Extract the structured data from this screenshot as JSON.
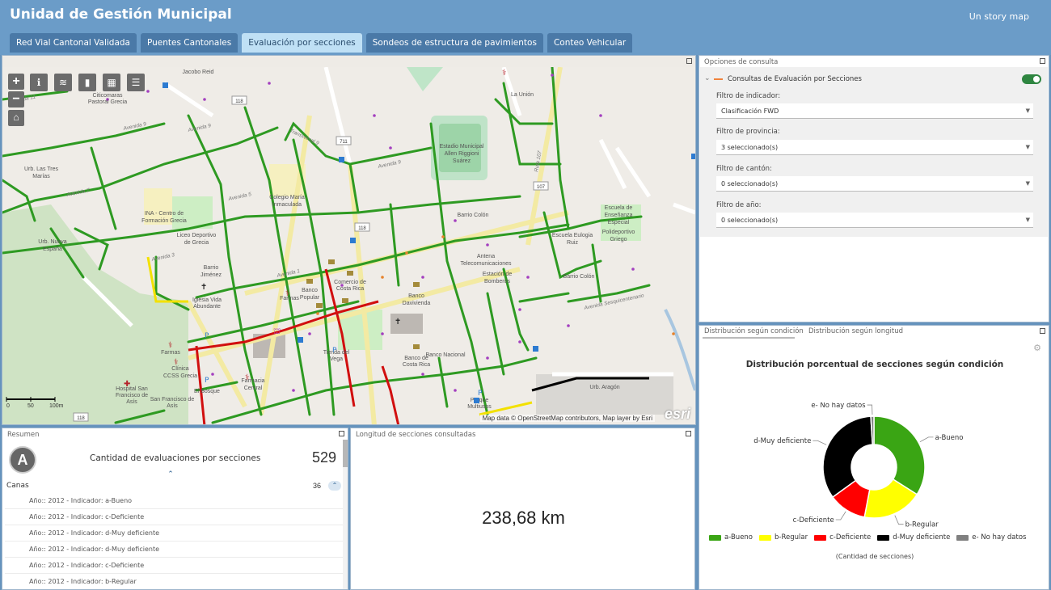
{
  "header": {
    "title": "Unidad de Gestión Municipal",
    "story_link": "Un story map"
  },
  "tabs": [
    {
      "label": "Red Vial Cantonal Validada",
      "active": false
    },
    {
      "label": "Puentes Cantonales",
      "active": false
    },
    {
      "label": "Evaluación por secciones",
      "active": true
    },
    {
      "label": "Sondeos de estructura de pavimientos",
      "active": false
    },
    {
      "label": "Conteo Vehicular",
      "active": false
    }
  ],
  "map": {
    "zoom_in": "+",
    "zoom_out": "−",
    "tools": [
      "info-icon",
      "layers-icon",
      "bookmark-icon",
      "basemap-icon",
      "legend-icon"
    ],
    "attribution": "Map data © OpenStreetMap contributors, Map layer by Esri",
    "esri_logo": "esri",
    "scale": {
      "labels": [
        "0",
        "50",
        "100m"
      ]
    },
    "places": [
      "La Unión",
      "Estadio Municipal Allen Riggioni Suárez",
      "Urb. Las Tres Marías",
      "Colegio María Inmaculada",
      "INA - Centro de Formación Grecia",
      "Liceo Deportivo de Grecia",
      "Barrio Colón",
      "Escuela de Enseñanza Especial",
      "Escuela Eulogia Ruiz",
      "Polideportivo Griego",
      "Urb. Nueva España",
      "Barrio Jiménez",
      "Banco Popular",
      "Farmas",
      "Barrio Colón",
      "Urb. Aragón",
      "Hospital San Francisco de Asís",
      "Clínica CCSS Grecia",
      "El Bosque",
      "Banco de Costa Rica",
      "Antena Telecomunicaciones",
      "Citicomaras Pastoral Grecia",
      "Banco Davivienda",
      "Comercio de Costa Rica",
      "Iglesia Vida Abundante",
      "Farmacia Central",
      "Parque Multiusos",
      "Estación de Bomberos",
      "Banco Nacional"
    ],
    "roads": [
      "Avenida 11",
      "Avenida 9",
      "Avenida 7",
      "Avenida 5",
      "Avenida 3",
      "Avenida 1",
      "Transversal 9",
      "Ruta 107",
      "Avenida Sesquicentenario"
    ],
    "route_shields": [
      "118",
      "711",
      "107",
      "118"
    ]
  },
  "options": {
    "panel_title": "Opciones de consulta",
    "group_label": "Consultas de Evaluación por Secciones",
    "filters": [
      {
        "label": "Filtro de indicador:",
        "value": "Clasificación FWD"
      },
      {
        "label": "Filtro de provincia:",
        "value": "3 seleccionado(s)"
      },
      {
        "label": "Filtro de cantón:",
        "value": "0 seleccionado(s)"
      },
      {
        "label": "Filtro de año:",
        "value": "0 seleccionado(s)"
      }
    ],
    "toggle_on": true
  },
  "resumen": {
    "panel_title": "Resumen",
    "badge": "A",
    "label": "Cantidad de evaluaciones por secciones",
    "count": "529",
    "group": {
      "name": "Canas",
      "count": "36"
    },
    "items": [
      "Año:: 2012 - Indicador: a-Bueno",
      "Año:: 2012 - Indicador: c-Deficiente",
      "Año:: 2012 - Indicador: d-Muy deficiente",
      "Año:: 2012 - Indicador: d-Muy deficiente",
      "Año:: 2012 - Indicador: c-Deficiente",
      "Año:: 2012 - Indicador: b-Regular"
    ]
  },
  "longitud": {
    "panel_title": "Longitud de secciones consultadas",
    "value": "238,68 km"
  },
  "distribution": {
    "tabs": [
      "Distribución según condición",
      "Distribución según longitud"
    ],
    "caption": "(Cantidad de secciones)"
  },
  "chart_data": {
    "type": "pie",
    "donut": true,
    "title": "Distribución porcentual de secciones según condición",
    "categories": [
      "a-Bueno",
      "b-Regular",
      "c-Deficiente",
      "d-Muy deficiente",
      "e- No hay datos"
    ],
    "values": [
      34,
      19,
      12,
      34,
      1
    ],
    "colors": [
      "#3aa514",
      "#ffff00",
      "#ff0000",
      "#000000",
      "#808080"
    ],
    "legend": "bottom"
  }
}
